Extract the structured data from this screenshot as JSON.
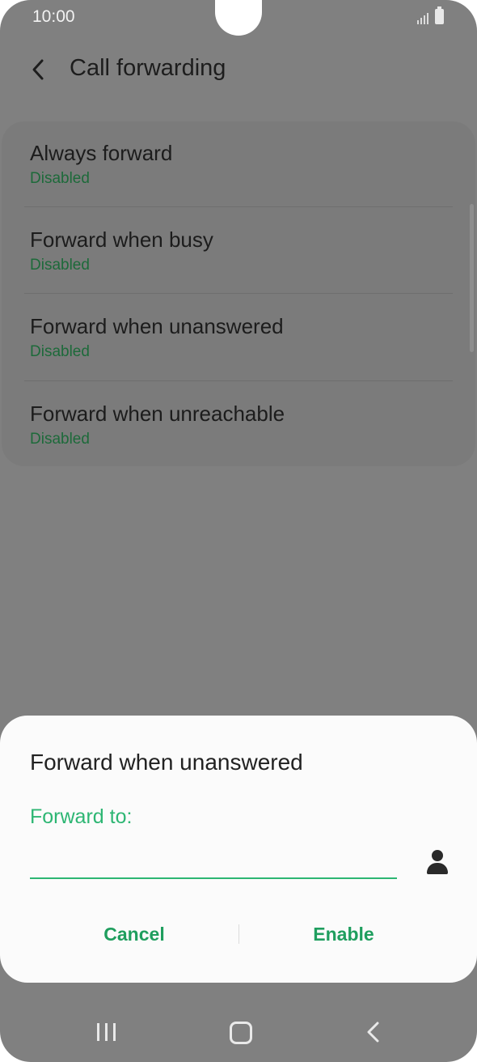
{
  "status_bar": {
    "time": "10:00"
  },
  "header": {
    "title": "Call forwarding"
  },
  "options": [
    {
      "title": "Always forward",
      "status": "Disabled"
    },
    {
      "title": "Forward when busy",
      "status": "Disabled"
    },
    {
      "title": "Forward when unanswered",
      "status": "Disabled"
    },
    {
      "title": "Forward when unreachable",
      "status": "Disabled"
    }
  ],
  "dialog": {
    "title": "Forward when unanswered",
    "field_label": "Forward to:",
    "field_value": "",
    "cancel_label": "Cancel",
    "enable_label": "Enable"
  },
  "colors": {
    "accent": "#2db673",
    "status_green": "#1d6a3a",
    "dim_overlay": "#808080"
  },
  "icons": {
    "back": "chevron-left-icon",
    "contact": "person-icon",
    "recents": "recents-icon",
    "home": "home-icon",
    "nav_back": "nav-back-icon"
  }
}
